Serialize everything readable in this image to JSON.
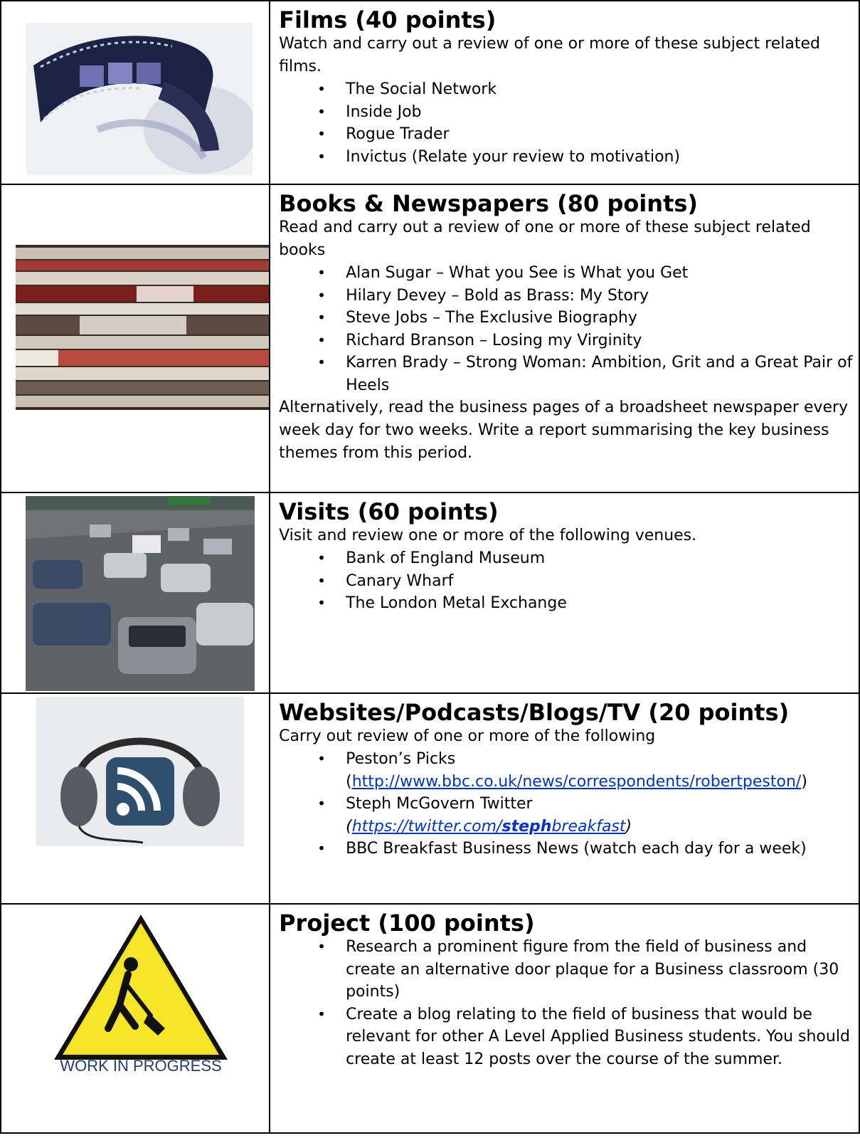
{
  "sections": [
    {
      "title": "Films (40 points)",
      "intro": "Watch and carry out a review of one or more of these subject related films.",
      "items": [
        "The Social Network",
        "Inside Job",
        "Rogue Trader",
        "Invictus (Relate your review to motivation)"
      ],
      "image": "film-reel"
    },
    {
      "title": "Books & Newspapers (80 points)",
      "intro": "Read and carry out a review of one or more of these subject related books",
      "items": [
        "Alan Sugar – What you See is What you Get",
        "Hilary Devey – Bold as Brass: My Story",
        "Steve Jobs – The Exclusive Biography",
        "Richard Branson – Losing my Virginity",
        "Karren Brady – Strong Woman: Ambition, Grit and a Great Pair of Heels"
      ],
      "outro": "Alternatively, read the business pages of a broadsheet newspaper every week day for two weeks.  Write a report summarising the key business themes from this period.",
      "image": "newspaper-stack"
    },
    {
      "title": "Visits (60 points)",
      "intro": "Visit and review one or more of the following venues.",
      "items": [
        "Bank of England Museum",
        "Canary Wharf",
        "The London Metal Exchange"
      ],
      "image": "traffic-photo"
    },
    {
      "title": "Websites/Podcasts/Blogs/TV (20 points)",
      "intro": "Carry out review of one or more of the following",
      "items": [
        {
          "text": " Peston’s Picks",
          "link_open": "(",
          "link": "http://www.bbc.co.uk/news/correspondents/robertpeston/",
          "link_close": ")"
        },
        {
          "text": "Steph McGovern Twitter",
          "link_open": "(",
          "link_pre": "https://twitter.com/",
          "link_bold": "steph",
          "link_post": "breakfast",
          "link_close": ")"
        },
        {
          "text": "BBC Breakfast Business News (watch each day for a week)"
        }
      ],
      "image": "headphones-rss-icon"
    },
    {
      "title": "Project (100 points)",
      "items": [
        "Research a prominent figure from the field of business and create an alternative door plaque for a Business classroom (30 points)",
        "Create a blog relating to the field of business that would be relevant for other A Level Applied Business students.  You should create at least 12 posts over the course of the summer."
      ],
      "image": "work-in-progress-sign",
      "sign_text": "WORK IN PROGRESS"
    }
  ]
}
